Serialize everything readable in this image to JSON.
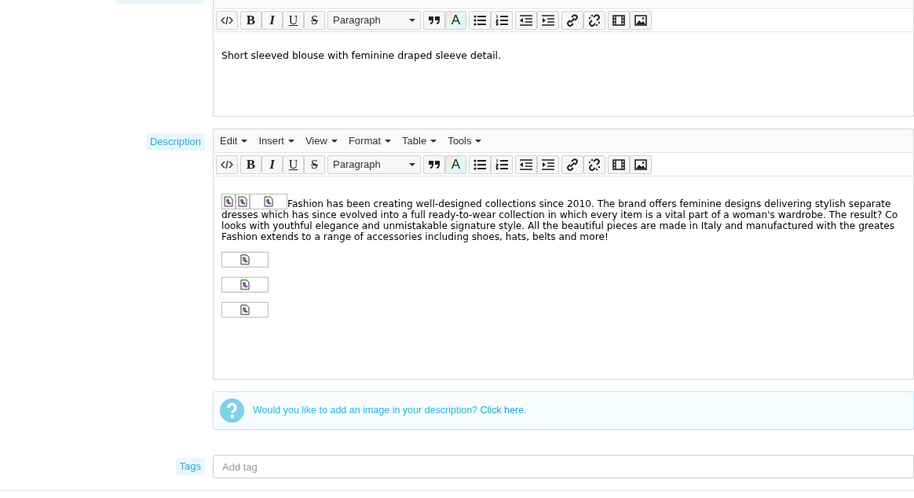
{
  "summary_editor": {
    "toolbar": {
      "format_select": "Paragraph",
      "bold": "B",
      "italic": "I",
      "underline": "U",
      "strike": "S",
      "text_color": "A"
    },
    "content": "Short sleeved blouse with feminine draped sleeve detail."
  },
  "description": {
    "label": "Description",
    "menu": [
      "Edit",
      "Insert",
      "View",
      "Format",
      "Table",
      "Tools"
    ],
    "toolbar": {
      "format_select": "Paragraph",
      "bold": "B",
      "italic": "I",
      "underline": "U",
      "strike": "S",
      "text_color": "A"
    },
    "lines": [
      "Fashion has been creating well-designed collections since 2010. The brand offers feminine designs delivering stylish separate",
      "dresses which has since evolved into a full ready-to-wear collection in which every item is a vital part of a woman's wardrobe. The result? Co",
      "looks with youthful elegance and unmistakable signature style. All the beautiful pieces are made in Italy and manufactured with the greates",
      "Fashion extends to a range of accessories including shoes, hats, belts and more!"
    ]
  },
  "image_hint": {
    "text": "Would you like to add an image in your description?",
    "link": "Click here."
  },
  "tags": {
    "label": "Tags",
    "placeholder": "Add tag"
  }
}
